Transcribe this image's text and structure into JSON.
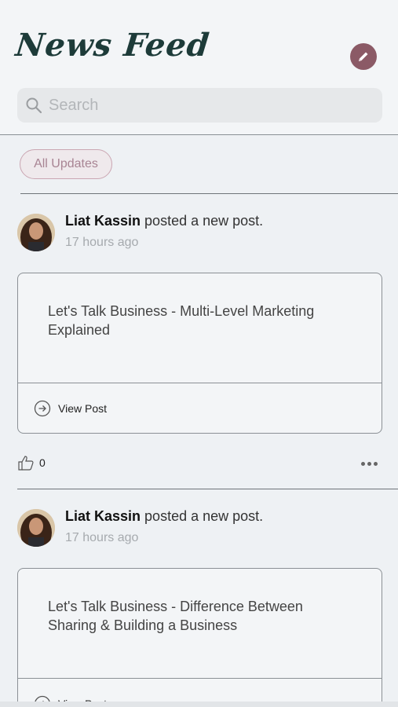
{
  "header": {
    "title": "News Feed",
    "edit_icon": "pencil-icon",
    "accent": "#8b5a66"
  },
  "search": {
    "placeholder": "Search",
    "icon": "search-icon"
  },
  "filter": {
    "label": "All Updates"
  },
  "posts": [
    {
      "author": "Liat Kassin",
      "action": "posted a new post.",
      "time": "17 hours ago",
      "title": "Let's Talk Business - Multi-Level Marketing Explained",
      "view_label": "View Post",
      "likes": "0"
    },
    {
      "author": "Liat Kassin",
      "action": "posted a new post.",
      "time": "17 hours ago",
      "title": "Let's Talk Business - Difference Between Sharing & Building a Business",
      "view_label": "View Post"
    }
  ]
}
